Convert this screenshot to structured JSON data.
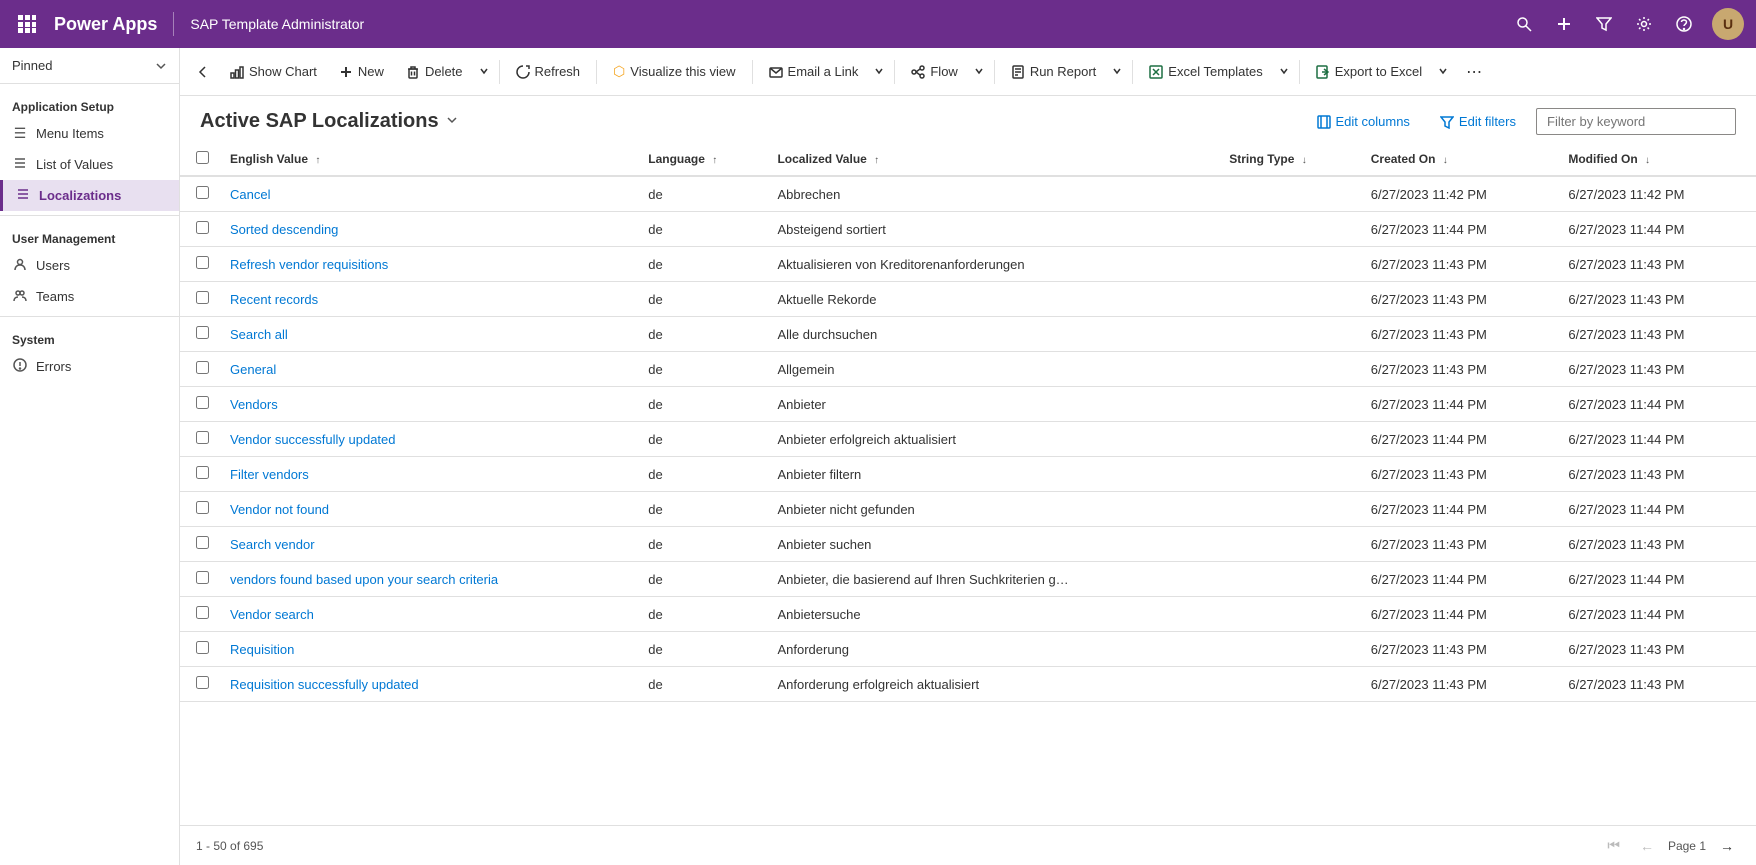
{
  "topbar": {
    "app_name": "Power Apps",
    "app_title": "SAP Template Administrator",
    "avatar_initials": "U"
  },
  "sidebar": {
    "pinned_label": "Pinned",
    "sections": [
      {
        "title": "Application Setup",
        "items": [
          {
            "id": "menu-items",
            "label": "Menu Items",
            "icon": "☰",
            "active": false
          },
          {
            "id": "list-of-values",
            "label": "List of Values",
            "icon": "≡",
            "active": false
          },
          {
            "id": "localizations",
            "label": "Localizations",
            "icon": "≡",
            "active": true
          }
        ]
      },
      {
        "title": "User Management",
        "items": [
          {
            "id": "users",
            "label": "Users",
            "icon": "👤",
            "active": false
          },
          {
            "id": "teams",
            "label": "Teams",
            "icon": "👥",
            "active": false
          }
        ]
      },
      {
        "title": "System",
        "items": [
          {
            "id": "errors",
            "label": "Errors",
            "icon": "⊙",
            "active": false
          }
        ]
      }
    ]
  },
  "command_bar": {
    "back_button": "←",
    "show_chart": "Show Chart",
    "new": "New",
    "delete": "Delete",
    "refresh": "Refresh",
    "visualize": "Visualize this view",
    "email_link": "Email a Link",
    "flow": "Flow",
    "run_report": "Run Report",
    "excel_templates": "Excel Templates",
    "export_to_excel": "Export to Excel"
  },
  "view": {
    "title": "Active SAP Localizations",
    "edit_columns": "Edit columns",
    "edit_filters": "Edit filters",
    "filter_placeholder": "Filter by keyword"
  },
  "table": {
    "columns": [
      {
        "id": "english_value",
        "label": "English Value",
        "sortable": true,
        "sort_dir": "asc"
      },
      {
        "id": "language",
        "label": "Language",
        "sortable": true,
        "sort_dir": "asc"
      },
      {
        "id": "localized_value",
        "label": "Localized Value",
        "sortable": true,
        "sort_dir": "asc"
      },
      {
        "id": "string_type",
        "label": "String Type",
        "sortable": true
      },
      {
        "id": "created_on",
        "label": "Created On",
        "sortable": true
      },
      {
        "id": "modified_on",
        "label": "Modified On",
        "sortable": true
      }
    ],
    "rows": [
      {
        "english_value": "Cancel",
        "language": "de",
        "localized_value": "Abbrechen",
        "string_type": "",
        "created_on": "6/27/2023 11:42 PM",
        "modified_on": "6/27/2023 11:42 PM"
      },
      {
        "english_value": "Sorted descending",
        "language": "de",
        "localized_value": "Absteigend sortiert",
        "string_type": "",
        "created_on": "6/27/2023 11:44 PM",
        "modified_on": "6/27/2023 11:44 PM"
      },
      {
        "english_value": "Refresh vendor requisitions",
        "language": "de",
        "localized_value": "Aktualisieren von Kreditorenanforderungen",
        "string_type": "",
        "created_on": "6/27/2023 11:43 PM",
        "modified_on": "6/27/2023 11:43 PM"
      },
      {
        "english_value": "Recent records",
        "language": "de",
        "localized_value": "Aktuelle Rekorde",
        "string_type": "",
        "created_on": "6/27/2023 11:43 PM",
        "modified_on": "6/27/2023 11:43 PM"
      },
      {
        "english_value": "Search all",
        "language": "de",
        "localized_value": "Alle durchsuchen",
        "string_type": "",
        "created_on": "6/27/2023 11:43 PM",
        "modified_on": "6/27/2023 11:43 PM"
      },
      {
        "english_value": "General",
        "language": "de",
        "localized_value": "Allgemein",
        "string_type": "",
        "created_on": "6/27/2023 11:43 PM",
        "modified_on": "6/27/2023 11:43 PM"
      },
      {
        "english_value": "Vendors",
        "language": "de",
        "localized_value": "Anbieter",
        "string_type": "",
        "created_on": "6/27/2023 11:44 PM",
        "modified_on": "6/27/2023 11:44 PM"
      },
      {
        "english_value": "Vendor successfully updated",
        "language": "de",
        "localized_value": "Anbieter erfolgreich aktualisiert",
        "string_type": "",
        "created_on": "6/27/2023 11:44 PM",
        "modified_on": "6/27/2023 11:44 PM"
      },
      {
        "english_value": "Filter vendors",
        "language": "de",
        "localized_value": "Anbieter filtern",
        "string_type": "",
        "created_on": "6/27/2023 11:43 PM",
        "modified_on": "6/27/2023 11:43 PM"
      },
      {
        "english_value": "Vendor not found",
        "language": "de",
        "localized_value": "Anbieter nicht gefunden",
        "string_type": "",
        "created_on": "6/27/2023 11:44 PM",
        "modified_on": "6/27/2023 11:44 PM"
      },
      {
        "english_value": "Search vendor",
        "language": "de",
        "localized_value": "Anbieter suchen",
        "string_type": "",
        "created_on": "6/27/2023 11:43 PM",
        "modified_on": "6/27/2023 11:43 PM"
      },
      {
        "english_value": "vendors found based upon your search criteria",
        "language": "de",
        "localized_value": "Anbieter, die basierend auf Ihren Suchkriterien g…",
        "string_type": "",
        "created_on": "6/27/2023 11:44 PM",
        "modified_on": "6/27/2023 11:44 PM"
      },
      {
        "english_value": "Vendor search",
        "language": "de",
        "localized_value": "Anbietersuche",
        "string_type": "",
        "created_on": "6/27/2023 11:44 PM",
        "modified_on": "6/27/2023 11:44 PM"
      },
      {
        "english_value": "Requisition",
        "language": "de",
        "localized_value": "Anforderung",
        "string_type": "",
        "created_on": "6/27/2023 11:43 PM",
        "modified_on": "6/27/2023 11:43 PM"
      },
      {
        "english_value": "Requisition successfully updated",
        "language": "de",
        "localized_value": "Anforderung erfolgreich aktualisiert",
        "string_type": "",
        "created_on": "6/27/2023 11:43 PM",
        "modified_on": "6/27/2023 11:43 PM"
      }
    ]
  },
  "footer": {
    "record_count": "1 - 50 of 695",
    "page_label": "Page 1"
  }
}
